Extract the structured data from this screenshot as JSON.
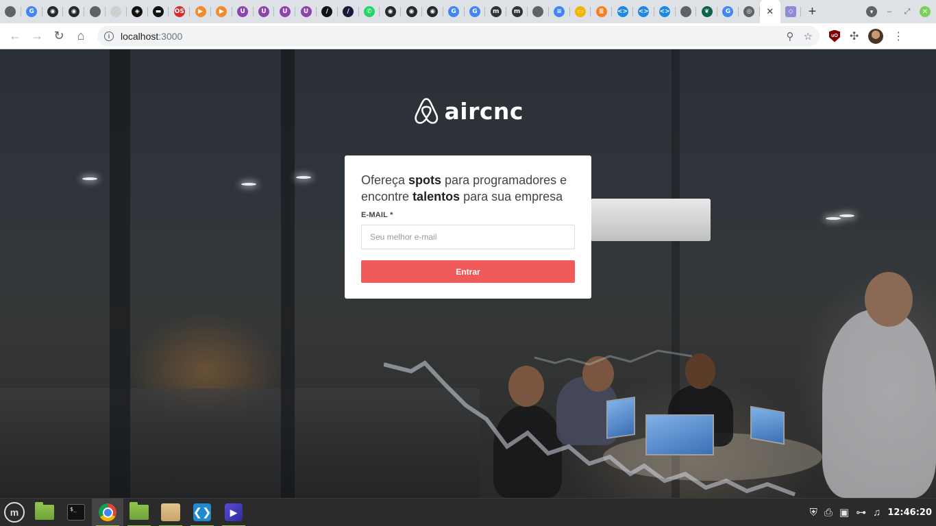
{
  "browser": {
    "tabs": [
      {
        "icon": "globe-icon",
        "color": "#5f6368",
        "glyph": ""
      },
      {
        "icon": "google-icon",
        "color": "#4285f4",
        "glyph": "G"
      },
      {
        "icon": "github-icon",
        "color": "#24292e",
        "glyph": "◉"
      },
      {
        "icon": "github-icon",
        "color": "#24292e",
        "glyph": "◉"
      },
      {
        "icon": "globe-icon",
        "color": "#5f6368",
        "glyph": ""
      },
      {
        "icon": "white-circle-icon",
        "color": "#cfcfcf",
        "glyph": ""
      },
      {
        "icon": "codepen-icon",
        "color": "#111111",
        "glyph": "◈"
      },
      {
        "icon": "dark-square-icon",
        "color": "#111111",
        "glyph": "▬"
      },
      {
        "icon": "os-icon",
        "color": "#d32f2f",
        "glyph": "OS"
      },
      {
        "icon": "flag-icon",
        "color": "#ef8c2e",
        "glyph": "▶"
      },
      {
        "icon": "flag-icon",
        "color": "#ef8c2e",
        "glyph": "▶"
      },
      {
        "icon": "purple-u-icon",
        "color": "#8e44ad",
        "glyph": "U"
      },
      {
        "icon": "purple-u-icon",
        "color": "#8e44ad",
        "glyph": "U"
      },
      {
        "icon": "purple-u-icon",
        "color": "#8e44ad",
        "glyph": "U"
      },
      {
        "icon": "purple-u-icon",
        "color": "#8e44ad",
        "glyph": "U"
      },
      {
        "icon": "dark-slash-icon",
        "color": "#111111",
        "glyph": "/"
      },
      {
        "icon": "dark-slash-icon",
        "color": "#1a1a3a",
        "glyph": "/"
      },
      {
        "icon": "whatsapp-icon",
        "color": "#25d366",
        "glyph": "✆"
      },
      {
        "icon": "github-icon",
        "color": "#24292e",
        "glyph": "◉"
      },
      {
        "icon": "github-icon",
        "color": "#24292e",
        "glyph": "◉"
      },
      {
        "icon": "github-icon",
        "color": "#24292e",
        "glyph": "◉"
      },
      {
        "icon": "google-icon",
        "color": "#4285f4",
        "glyph": "G"
      },
      {
        "icon": "google-icon",
        "color": "#4285f4",
        "glyph": "G"
      },
      {
        "icon": "medium-icon",
        "color": "#333333",
        "glyph": "m"
      },
      {
        "icon": "medium-icon",
        "color": "#333333",
        "glyph": "m"
      },
      {
        "icon": "globe-icon",
        "color": "#5f6368",
        "glyph": ""
      },
      {
        "icon": "google-docs-icon",
        "color": "#4285f4",
        "glyph": "≡"
      },
      {
        "icon": "google-slides-icon",
        "color": "#f4b400",
        "glyph": "▭"
      },
      {
        "icon": "stackoverflow-icon",
        "color": "#f48024",
        "glyph": "≣"
      },
      {
        "icon": "code-icon",
        "color": "#1e88e5",
        "glyph": "<>"
      },
      {
        "icon": "code-icon",
        "color": "#1e88e5",
        "glyph": "<>"
      },
      {
        "icon": "code-icon",
        "color": "#1e88e5",
        "glyph": "<>"
      },
      {
        "icon": "globe-icon",
        "color": "#5f6368",
        "glyph": ""
      },
      {
        "icon": "mongodb-icon",
        "color": "#116149",
        "glyph": "❦"
      },
      {
        "icon": "google-icon",
        "color": "#4285f4",
        "glyph": "G"
      },
      {
        "icon": "chrome-icon",
        "color": "#5f6368",
        "glyph": "◎"
      }
    ],
    "active_tab_close": "✕",
    "last_tab": {
      "icon": "extension-page-icon",
      "color": "#8c8cd6",
      "glyph": "◇"
    },
    "new_tab": "+",
    "url_host": "localhost",
    "url_port": ":3000",
    "info_glyph": "i"
  },
  "page": {
    "brand": "aircnc",
    "headline_part1": "Ofereça ",
    "headline_bold1": "spots",
    "headline_part2": " para programadores e encontre ",
    "headline_bold2": "talentos",
    "headline_part3": " para sua empresa",
    "email_label": "E-MAIL *",
    "email_placeholder": "Seu melhor e-mail",
    "submit_label": "Entrar",
    "accent_color": "#f05a5b"
  },
  "taskbar": {
    "clock": "12:46:20",
    "terminal_prompt": "$_"
  }
}
